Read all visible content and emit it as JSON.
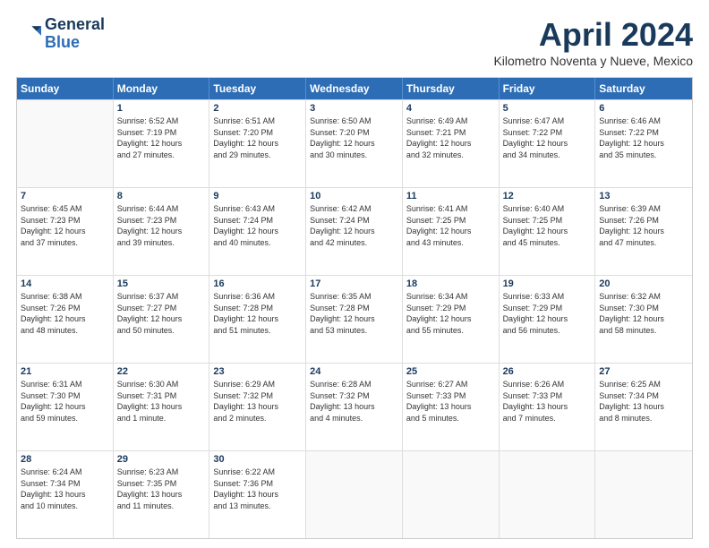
{
  "header": {
    "logo_line1": "General",
    "logo_line2": "Blue",
    "month": "April 2024",
    "location": "Kilometro Noventa y Nueve, Mexico"
  },
  "days": [
    "Sunday",
    "Monday",
    "Tuesday",
    "Wednesday",
    "Thursday",
    "Friday",
    "Saturday"
  ],
  "rows": [
    [
      {
        "day": "",
        "lines": []
      },
      {
        "day": "1",
        "lines": [
          "Sunrise: 6:52 AM",
          "Sunset: 7:19 PM",
          "Daylight: 12 hours",
          "and 27 minutes."
        ]
      },
      {
        "day": "2",
        "lines": [
          "Sunrise: 6:51 AM",
          "Sunset: 7:20 PM",
          "Daylight: 12 hours",
          "and 29 minutes."
        ]
      },
      {
        "day": "3",
        "lines": [
          "Sunrise: 6:50 AM",
          "Sunset: 7:20 PM",
          "Daylight: 12 hours",
          "and 30 minutes."
        ]
      },
      {
        "day": "4",
        "lines": [
          "Sunrise: 6:49 AM",
          "Sunset: 7:21 PM",
          "Daylight: 12 hours",
          "and 32 minutes."
        ]
      },
      {
        "day": "5",
        "lines": [
          "Sunrise: 6:47 AM",
          "Sunset: 7:22 PM",
          "Daylight: 12 hours",
          "and 34 minutes."
        ]
      },
      {
        "day": "6",
        "lines": [
          "Sunrise: 6:46 AM",
          "Sunset: 7:22 PM",
          "Daylight: 12 hours",
          "and 35 minutes."
        ]
      }
    ],
    [
      {
        "day": "7",
        "lines": [
          "Sunrise: 6:45 AM",
          "Sunset: 7:23 PM",
          "Daylight: 12 hours",
          "and 37 minutes."
        ]
      },
      {
        "day": "8",
        "lines": [
          "Sunrise: 6:44 AM",
          "Sunset: 7:23 PM",
          "Daylight: 12 hours",
          "and 39 minutes."
        ]
      },
      {
        "day": "9",
        "lines": [
          "Sunrise: 6:43 AM",
          "Sunset: 7:24 PM",
          "Daylight: 12 hours",
          "and 40 minutes."
        ]
      },
      {
        "day": "10",
        "lines": [
          "Sunrise: 6:42 AM",
          "Sunset: 7:24 PM",
          "Daylight: 12 hours",
          "and 42 minutes."
        ]
      },
      {
        "day": "11",
        "lines": [
          "Sunrise: 6:41 AM",
          "Sunset: 7:25 PM",
          "Daylight: 12 hours",
          "and 43 minutes."
        ]
      },
      {
        "day": "12",
        "lines": [
          "Sunrise: 6:40 AM",
          "Sunset: 7:25 PM",
          "Daylight: 12 hours",
          "and 45 minutes."
        ]
      },
      {
        "day": "13",
        "lines": [
          "Sunrise: 6:39 AM",
          "Sunset: 7:26 PM",
          "Daylight: 12 hours",
          "and 47 minutes."
        ]
      }
    ],
    [
      {
        "day": "14",
        "lines": [
          "Sunrise: 6:38 AM",
          "Sunset: 7:26 PM",
          "Daylight: 12 hours",
          "and 48 minutes."
        ]
      },
      {
        "day": "15",
        "lines": [
          "Sunrise: 6:37 AM",
          "Sunset: 7:27 PM",
          "Daylight: 12 hours",
          "and 50 minutes."
        ]
      },
      {
        "day": "16",
        "lines": [
          "Sunrise: 6:36 AM",
          "Sunset: 7:28 PM",
          "Daylight: 12 hours",
          "and 51 minutes."
        ]
      },
      {
        "day": "17",
        "lines": [
          "Sunrise: 6:35 AM",
          "Sunset: 7:28 PM",
          "Daylight: 12 hours",
          "and 53 minutes."
        ]
      },
      {
        "day": "18",
        "lines": [
          "Sunrise: 6:34 AM",
          "Sunset: 7:29 PM",
          "Daylight: 12 hours",
          "and 55 minutes."
        ]
      },
      {
        "day": "19",
        "lines": [
          "Sunrise: 6:33 AM",
          "Sunset: 7:29 PM",
          "Daylight: 12 hours",
          "and 56 minutes."
        ]
      },
      {
        "day": "20",
        "lines": [
          "Sunrise: 6:32 AM",
          "Sunset: 7:30 PM",
          "Daylight: 12 hours",
          "and 58 minutes."
        ]
      }
    ],
    [
      {
        "day": "21",
        "lines": [
          "Sunrise: 6:31 AM",
          "Sunset: 7:30 PM",
          "Daylight: 12 hours",
          "and 59 minutes."
        ]
      },
      {
        "day": "22",
        "lines": [
          "Sunrise: 6:30 AM",
          "Sunset: 7:31 PM",
          "Daylight: 13 hours",
          "and 1 minute."
        ]
      },
      {
        "day": "23",
        "lines": [
          "Sunrise: 6:29 AM",
          "Sunset: 7:32 PM",
          "Daylight: 13 hours",
          "and 2 minutes."
        ]
      },
      {
        "day": "24",
        "lines": [
          "Sunrise: 6:28 AM",
          "Sunset: 7:32 PM",
          "Daylight: 13 hours",
          "and 4 minutes."
        ]
      },
      {
        "day": "25",
        "lines": [
          "Sunrise: 6:27 AM",
          "Sunset: 7:33 PM",
          "Daylight: 13 hours",
          "and 5 minutes."
        ]
      },
      {
        "day": "26",
        "lines": [
          "Sunrise: 6:26 AM",
          "Sunset: 7:33 PM",
          "Daylight: 13 hours",
          "and 7 minutes."
        ]
      },
      {
        "day": "27",
        "lines": [
          "Sunrise: 6:25 AM",
          "Sunset: 7:34 PM",
          "Daylight: 13 hours",
          "and 8 minutes."
        ]
      }
    ],
    [
      {
        "day": "28",
        "lines": [
          "Sunrise: 6:24 AM",
          "Sunset: 7:34 PM",
          "Daylight: 13 hours",
          "and 10 minutes."
        ]
      },
      {
        "day": "29",
        "lines": [
          "Sunrise: 6:23 AM",
          "Sunset: 7:35 PM",
          "Daylight: 13 hours",
          "and 11 minutes."
        ]
      },
      {
        "day": "30",
        "lines": [
          "Sunrise: 6:22 AM",
          "Sunset: 7:36 PM",
          "Daylight: 13 hours",
          "and 13 minutes."
        ]
      },
      {
        "day": "",
        "lines": []
      },
      {
        "day": "",
        "lines": []
      },
      {
        "day": "",
        "lines": []
      },
      {
        "day": "",
        "lines": []
      }
    ]
  ]
}
